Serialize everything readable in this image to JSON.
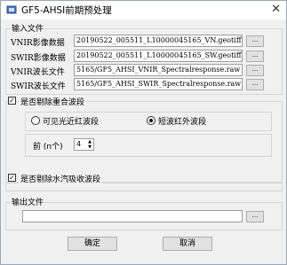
{
  "window": {
    "title": "GF5-AHSI前期预处理",
    "close_glyph": "✕"
  },
  "input_group": {
    "label": "输入文件",
    "rows": [
      {
        "label": "VNIR影像数据",
        "value": "20190522_005511_L10000045165_VN.geotiff",
        "button": "..."
      },
      {
        "label": "SWIR影像数据",
        "value": "20190522_005511_L10000045165_SW.geotiff",
        "button": "..."
      },
      {
        "label": "VNIR波长文件",
        "value": "5165/GF5_AHSI_VNIR_Spectralresponse.raw",
        "button": "..."
      },
      {
        "label": "SWIR波长文件",
        "value": "5165/GF5_AHSI_SWIR_Spectralresponse.raw",
        "button": "..."
      }
    ]
  },
  "overlap_group": {
    "label": "是否剔除重合波段",
    "checked_glyph": "✓",
    "radio_vnir": "可见光近红波段",
    "radio_swir": "短波红外波段",
    "selected": "短波红外波段",
    "front_label": "前 (n个)",
    "front_value": "4",
    "spin_up": "▲",
    "spin_down": "▼"
  },
  "water_group": {
    "label": "是否剔除水汽吸收波段",
    "checked_glyph": "✓"
  },
  "output_group": {
    "label": "输出文件",
    "value": "",
    "button": "..."
  },
  "buttons": {
    "ok": "确定",
    "cancel": "取消"
  },
  "colors": {
    "border": "#d5d5d5",
    "button_face": "#e1e1e1",
    "field_border": "#9d9d9d"
  }
}
